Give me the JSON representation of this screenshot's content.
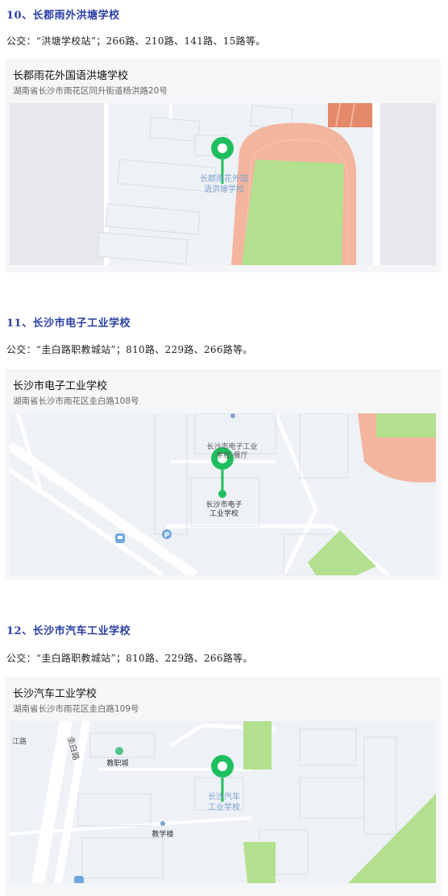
{
  "sections": [
    {
      "heading": "10、长郡雨外洪塘学校",
      "bus": "公交：“洪塘学校站”；266路、210路、141路、15路等。",
      "card": {
        "name": "长郡雨花外国语洪塘学校",
        "address": "湖南省长沙市雨花区同升街道杨洪路20号",
        "map_label_line1": "长郡雨花外国",
        "map_label_line2": "语洪塘学校"
      }
    },
    {
      "heading": "11、长沙市电子工业学校",
      "bus": "公交：“圭白路职教城站”；810路、229路、266路等。",
      "card": {
        "name": "长沙市电子工业学校",
        "address": "湖南省长沙市雨花区圭白路108号",
        "map_label_line1": "长沙市电子",
        "map_label_line2": "工业学校",
        "poi_line1": "长沙市电子工业",
        "poi_line2": "学校-餐厅"
      }
    },
    {
      "heading": "12、长沙市汽车工业学校",
      "bus": "公交：“圭白路职教城站”；810路、229路、266路等。",
      "card": {
        "name": "长沙汽车工业学校",
        "address": "湖南省长沙市雨花区圭白路109号",
        "map_label_line1": "长沙汽车",
        "map_label_line2": "工业学校",
        "road_label": "圭白路",
        "poi_1": "教职城",
        "poi_2": "教学楼",
        "edge_label": "江路"
      }
    }
  ],
  "colors": {
    "heading": "#2a3fa6",
    "pin": "#1fbf5f",
    "track": "#f2b59e",
    "field": "#b3e08e",
    "map_bg": "#eef1f6",
    "road": "#ffffff"
  }
}
